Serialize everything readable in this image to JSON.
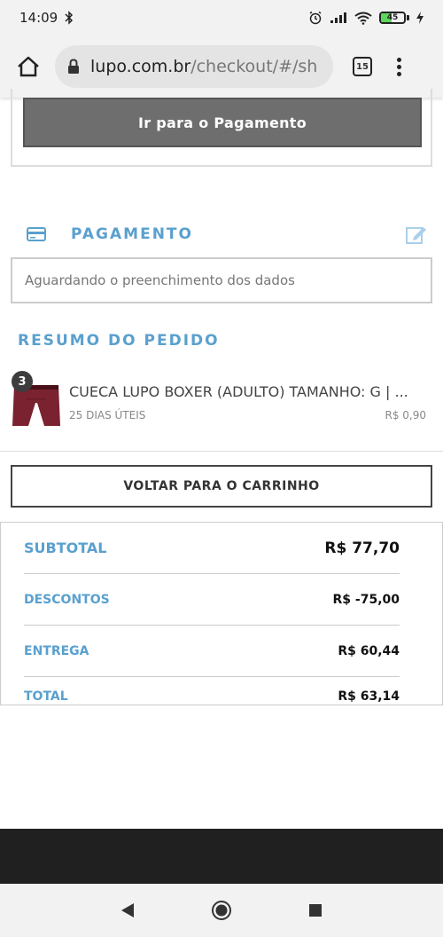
{
  "status_bar": {
    "time": "14:09",
    "battery": "45",
    "battery_level": 0.45,
    "icons": [
      "bluetooth-icon",
      "alarm-icon",
      "signal-icon",
      "wifi-icon",
      "battery-icon",
      "charging-icon"
    ]
  },
  "browser": {
    "url_domain": "lupo.com.br",
    "url_path": "/checkout/#/sh",
    "tab_count": "15",
    "icons": [
      "home-icon",
      "lock-icon",
      "menu-dots-icon"
    ]
  },
  "shipping": {
    "pay_button_label": "Ir para o Pagamento"
  },
  "payment": {
    "title": "PAGAMENTO",
    "placeholder_text": "Aguardando o preenchimento dos dados",
    "icons": [
      "credit-card-icon",
      "edit-icon"
    ]
  },
  "summary": {
    "title": "RESUMO DO PEDIDO",
    "items": [
      {
        "quantity": "3",
        "name": "CUECA LUPO BOXER (ADULTO) TAMANHO: G | ...",
        "delivery": "25 DIAS ÚTEIS",
        "price": "R$ 0,90"
      }
    ],
    "back_button_label": "VOLTAR PARA O CARRINHO"
  },
  "totals": {
    "subtotal_label": "SUBTOTAL",
    "subtotal_value": "R$ 77,70",
    "discount_label": "DESCONTOS",
    "discount_value": "R$ -75,00",
    "shipping_label": "ENTREGA",
    "shipping_value": "R$ 60,44",
    "total_label": "TOTAL",
    "total_value": "R$ 63,14"
  },
  "colors": {
    "accent_blue": "#5aa0cf",
    "button_gray": "#6e6e6e",
    "product_maroon": "#7a2230"
  },
  "nav_bar": {
    "icons": [
      "back-icon",
      "home-circle-icon",
      "recents-icon"
    ]
  }
}
